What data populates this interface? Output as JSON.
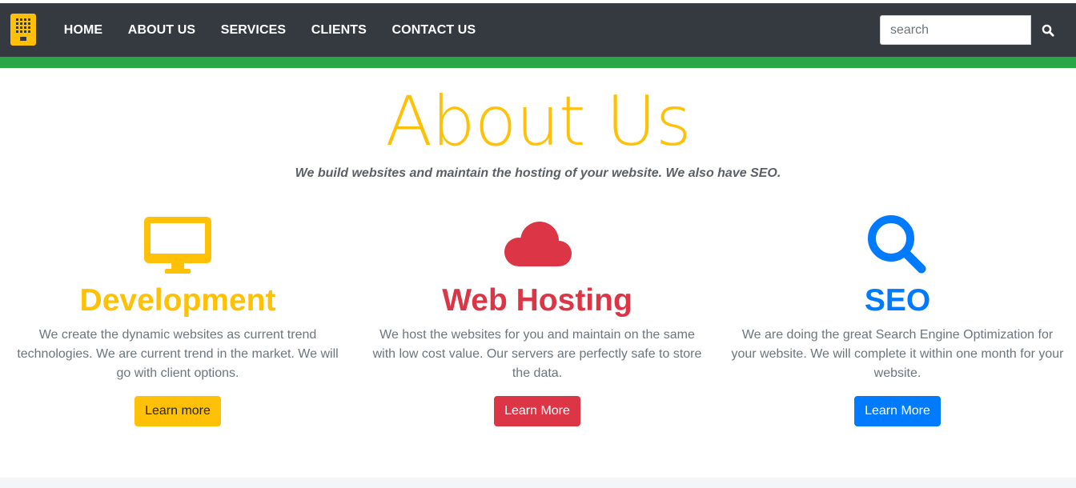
{
  "nav": {
    "logo_icon": "building-logo-icon",
    "links": [
      "HOME",
      "ABOUT US",
      "SERVICES",
      "CLIENTS",
      "CONTACT US"
    ],
    "search": {
      "placeholder": "search",
      "value": "",
      "button_icon": "search-icon"
    }
  },
  "colors": {
    "navbar": "#343a40",
    "accent_bar": "#28a745",
    "yellow": "#ffc107",
    "red": "#dc3545",
    "blue": "#007bff"
  },
  "about": {
    "title": "About Us",
    "subtitle": "We build websites and maintain the hosting of your website. We also have SEO."
  },
  "services": [
    {
      "icon": "desktop-monitor-icon",
      "title": "Development",
      "text": "We create the dynamic websites as current trend technologies. We are current trend in the market. We will go with client options.",
      "button": "Learn more"
    },
    {
      "icon": "cloud-icon",
      "title": "Web Hosting",
      "text": "We host the websites for you and maintain on the same with low cost value. Our servers are perfectly safe to store the data.",
      "button": "Learn More"
    },
    {
      "icon": "search-icon",
      "title": "SEO",
      "text": "We are doing the great Search Engine Optimization for your website. We will complete it within one month for your website.",
      "button": "Learn More"
    }
  ]
}
